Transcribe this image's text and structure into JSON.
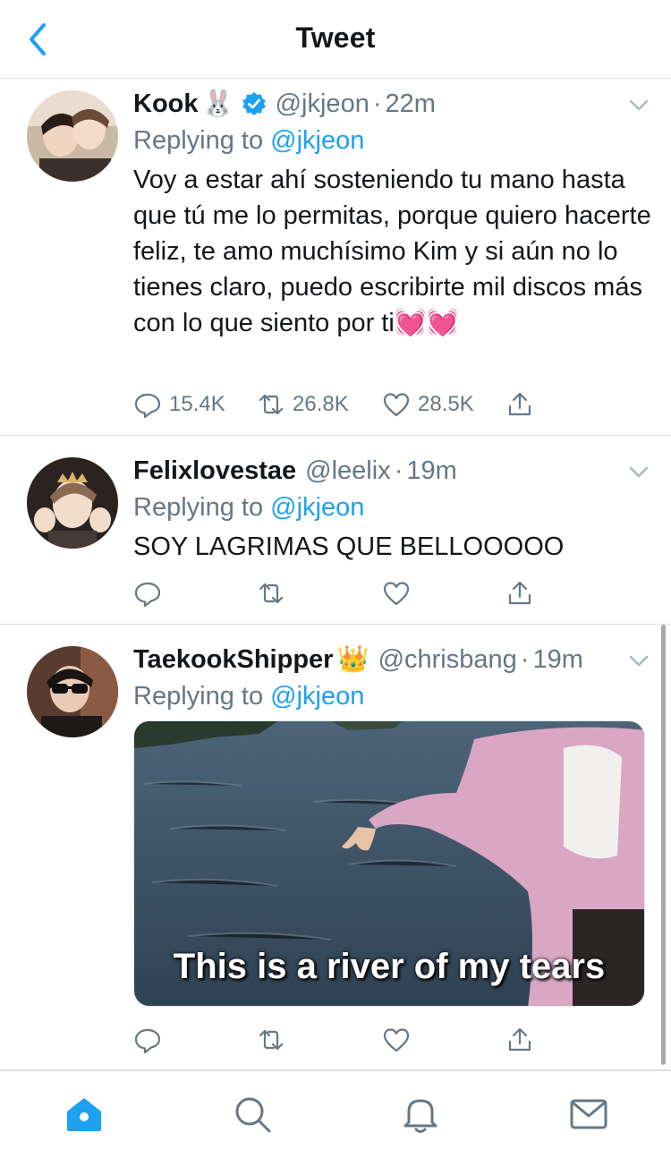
{
  "header": {
    "title": "Tweet"
  },
  "tweets": [
    {
      "name": "Kook",
      "name_emoji": "🐰",
      "verified": true,
      "handle": "@jkjeon",
      "time": "22m",
      "replying_prefix": "Replying to",
      "replying_to": "@jkjeon",
      "text": "Voy a estar ahí sosteniendo tu mano hasta que tú me lo permitas, porque quiero hacerte feliz, te amo muchísimo Kim y si aún no lo tienes claro, puedo escribirte mil discos más con lo que siento por ti💓💓",
      "replies": "15.4K",
      "retweets": "26.8K",
      "likes": "28.5K"
    },
    {
      "name": "Felixlovestae",
      "handle": "@leelix",
      "time": "19m",
      "replying_prefix": "Replying to",
      "replying_to": "@jkjeon",
      "text": "SOY LAGRIMAS QUE BELLOOOOO"
    },
    {
      "name": "TaekookShipper",
      "name_emoji": "👑",
      "handle": "@chrisbang",
      "time": "19m",
      "replying_prefix": "Replying to",
      "replying_to": "@jkjeon",
      "media_caption": "This is a river of my tears"
    }
  ],
  "colors": {
    "accent": "#1da1f2",
    "muted": "#657786",
    "text": "#14171a",
    "divider": "#d8dde1"
  },
  "icons": {
    "back": "chevron-left-icon",
    "reply": "reply-icon",
    "retweet": "retweet-icon",
    "like": "heart-icon",
    "share": "share-icon",
    "home": "home-icon",
    "search": "search-icon",
    "notifications": "bell-icon",
    "messages": "mail-icon"
  }
}
